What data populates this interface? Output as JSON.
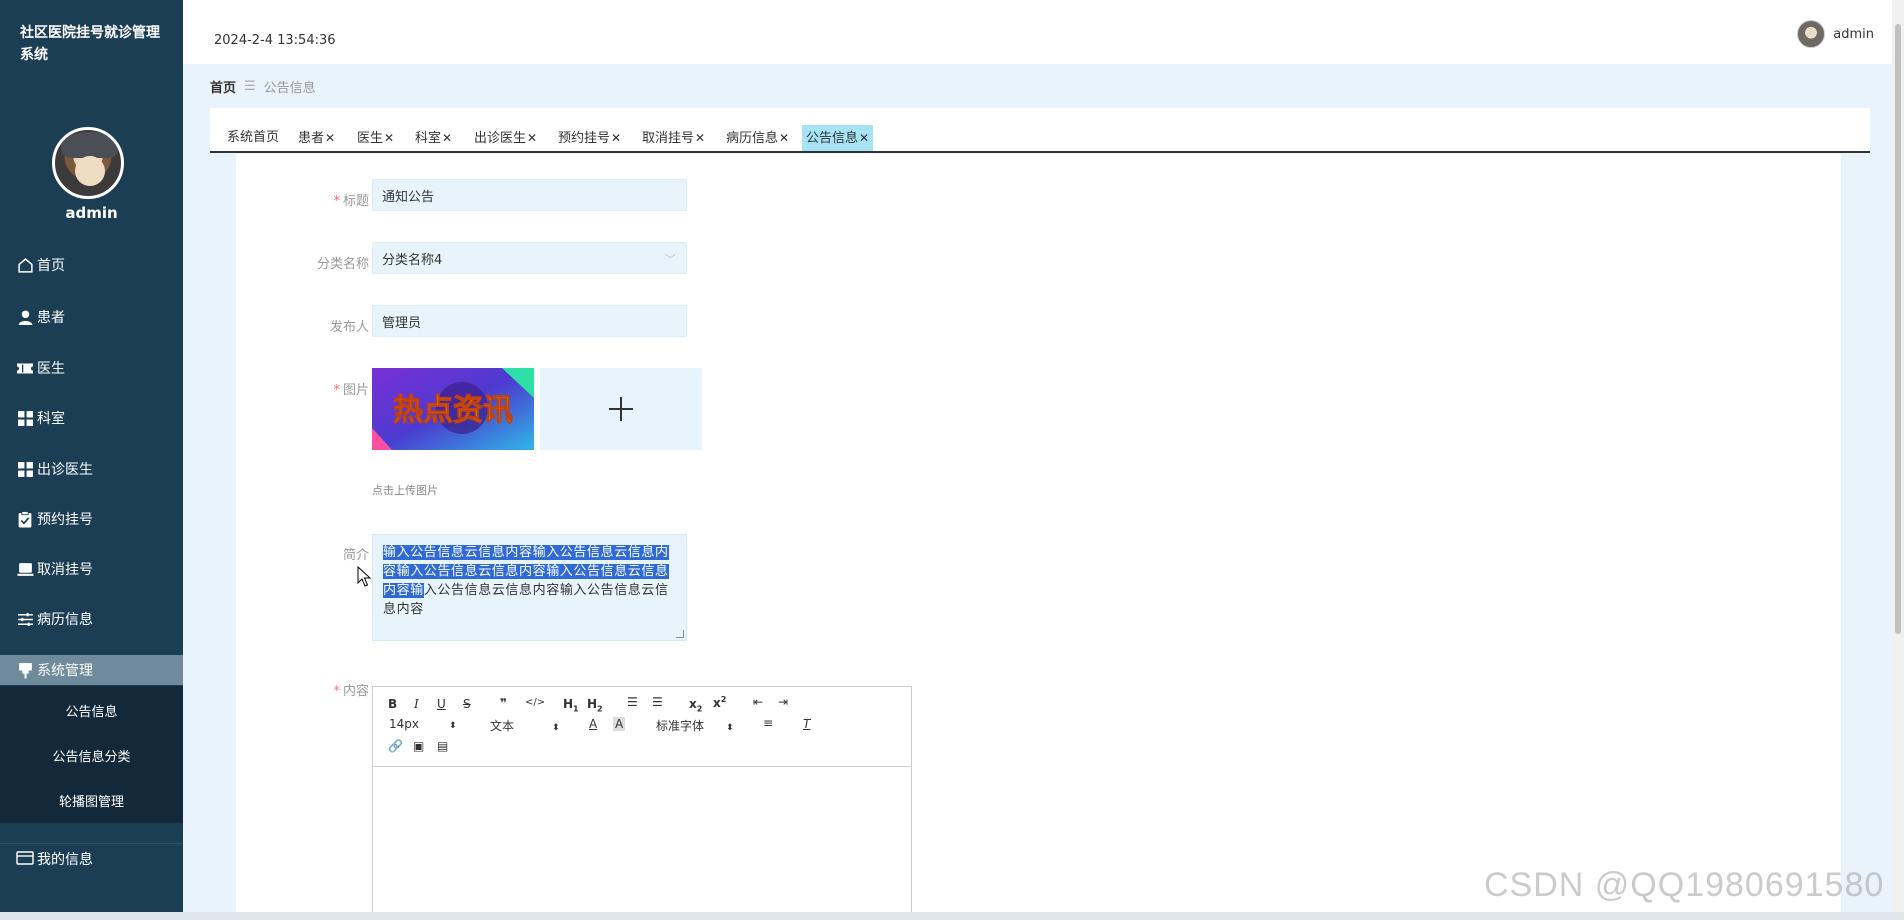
{
  "sidebar": {
    "title": "社区医院挂号就诊管理系统",
    "username": "admin",
    "items": [
      {
        "label": "首页",
        "icon": "home-icon"
      },
      {
        "label": "患者",
        "icon": "user-icon"
      },
      {
        "label": "医生",
        "icon": "ticket-icon"
      },
      {
        "label": "科室",
        "icon": "grid-icon"
      },
      {
        "label": "出诊医生",
        "icon": "grid-icon"
      },
      {
        "label": "预约挂号",
        "icon": "clipboard-check-icon"
      },
      {
        "label": "取消挂号",
        "icon": "laptop-icon"
      },
      {
        "label": "病历信息",
        "icon": "sliders-icon"
      },
      {
        "label": "系统管理",
        "icon": "pin-icon"
      }
    ],
    "submenu": [
      "公告信息",
      "公告信息分类",
      "轮播图管理"
    ],
    "my_info": "我的信息"
  },
  "header": {
    "datetime": "2024-2-4 13:54:36",
    "user": "admin"
  },
  "breadcrumb": {
    "home": "首页",
    "sep": "☰",
    "current": "公告信息"
  },
  "tabs": [
    {
      "label": "系统首页",
      "closable": false
    },
    {
      "label": "患者",
      "closable": true
    },
    {
      "label": "医生",
      "closable": true
    },
    {
      "label": "科室",
      "closable": true
    },
    {
      "label": "出诊医生",
      "closable": true
    },
    {
      "label": "预约挂号",
      "closable": true
    },
    {
      "label": "取消挂号",
      "closable": true
    },
    {
      "label": "病历信息",
      "closable": true
    },
    {
      "label": "公告信息",
      "closable": true,
      "active": true
    }
  ],
  "form": {
    "title_label": "标题",
    "title_value": "通知公告",
    "category_label": "分类名称",
    "category_value": "分类名称4",
    "publisher_label": "发布人",
    "publisher_value": "管理员",
    "image_label": "图片",
    "image_text": "热点资讯",
    "upload_hint": "点击上传图片",
    "intro_label": "简介",
    "intro_selected": "输入公告信息云信息内容输入公告信息云信息内容输入公告信息云信息内容输入公告信息云信息内容输",
    "intro_rest": "入公告信息云信息内容输入公告信息云信息内容",
    "content_label": "内容",
    "required_mark": "*"
  },
  "editor": {
    "font_size": "14px",
    "heading": "文本",
    "font_family": "标准字体"
  },
  "watermark": "CSDN @QQ1980691580"
}
